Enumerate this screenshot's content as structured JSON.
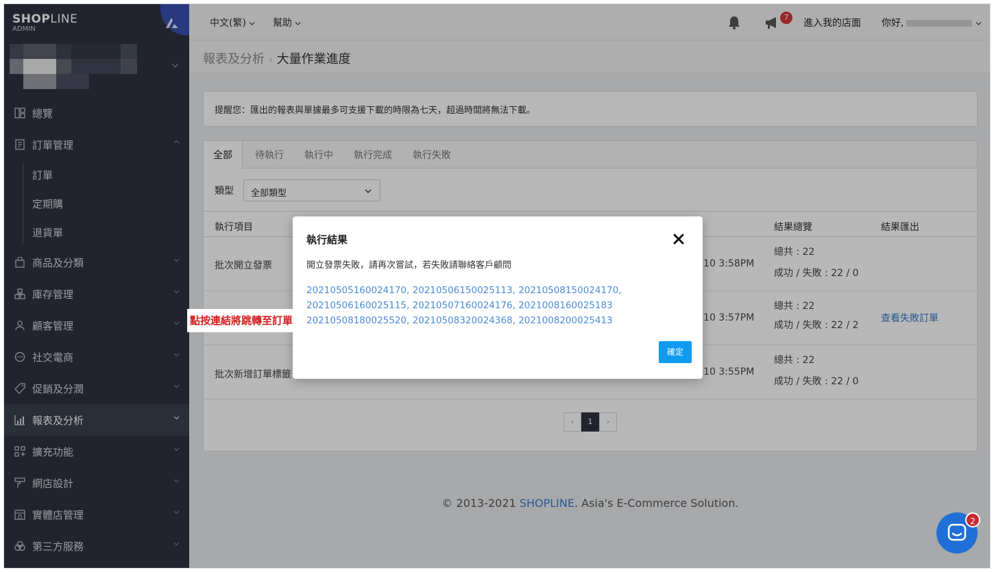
{
  "brand": {
    "name_bold": "SHOP",
    "name_light": "LINE",
    "sub": "ADMIN"
  },
  "sidebar": {
    "items": [
      {
        "label": "總覽",
        "icon": "dashboard-icon"
      },
      {
        "label": "訂單管理",
        "icon": "order-icon",
        "expanded": true
      },
      {
        "label": "商品及分類",
        "icon": "bag-icon"
      },
      {
        "label": "庫存管理",
        "icon": "inventory-icon"
      },
      {
        "label": "顧客管理",
        "icon": "user-icon"
      },
      {
        "label": "社交電商",
        "icon": "chat-icon"
      },
      {
        "label": "促銷及分潤",
        "icon": "tag-icon"
      },
      {
        "label": "報表及分析",
        "icon": "chart-icon",
        "active": true
      },
      {
        "label": "擴充功能",
        "icon": "apps-icon"
      },
      {
        "label": "網店設計",
        "icon": "design-icon"
      },
      {
        "label": "實體店管理",
        "icon": "store-icon"
      },
      {
        "label": "第三方服務",
        "icon": "third-party-icon"
      }
    ],
    "order_sub": [
      "訂單",
      "定期購",
      "退貨單"
    ]
  },
  "header": {
    "lang": "中文(繁)",
    "help": "幫助",
    "notify_count": "7",
    "store_link": "進入我的店面",
    "greeting": "你好,"
  },
  "breadcrumb": {
    "parent": "報表及分析",
    "current": "大量作業進度"
  },
  "notice": "提醒您：匯出的報表與單據最多可支援下載的時限為七天，超過時間將無法下載。",
  "tabs": [
    "全部",
    "待執行",
    "執行中",
    "執行完成",
    "執行失敗"
  ],
  "filter": {
    "label": "類型",
    "value": "全部類型"
  },
  "table": {
    "headers": {
      "item": "執行項目",
      "summary": "結果總覽",
      "export": "結果匯出"
    },
    "rows": [
      {
        "item": "批次開立發票",
        "time": "-10 3:58PM",
        "total": "總共 : 22",
        "result": "成功 / 失敗 : 22 / 0",
        "export": ""
      },
      {
        "item": "",
        "time": "-10 3:57PM",
        "total": "總共 : 22",
        "result": "成功 / 失敗 : 22 / 2",
        "export": "查看失敗訂單"
      },
      {
        "item": "批次新增訂單標籤",
        "time": "-10 3:55PM",
        "total": "總共 : 22",
        "result": "成功 / 失敗 : 22 / 0",
        "export": ""
      }
    ]
  },
  "pager": {
    "prev": "‹",
    "current": "1",
    "next": "›"
  },
  "footer": {
    "prefix": "© 2013-2021 ",
    "brand": "SHOPLINE",
    "suffix": ". Asia's E-Commerce Solution."
  },
  "modal": {
    "title": "執行結果",
    "message": "開立發票失敗，請再次嘗試，若失敗請聯絡客戶顧問",
    "order_links": [
      "20210505160024170,",
      "20210506150025113,",
      "20210508150024170,",
      "20210506160025115,",
      "20210507160024176,",
      "2021008160025183",
      "20210508180025520,",
      "20210508320024368,",
      "2021008200025413"
    ],
    "ok_label": "確定"
  },
  "annotation": "點按連結將跳轉至訂單",
  "chat": {
    "badge": "2"
  },
  "colors": {
    "sidebar": "#2f3340",
    "accent": "#0e9bf0",
    "link": "#4a8bd6",
    "annotation": "#d21f1f"
  }
}
